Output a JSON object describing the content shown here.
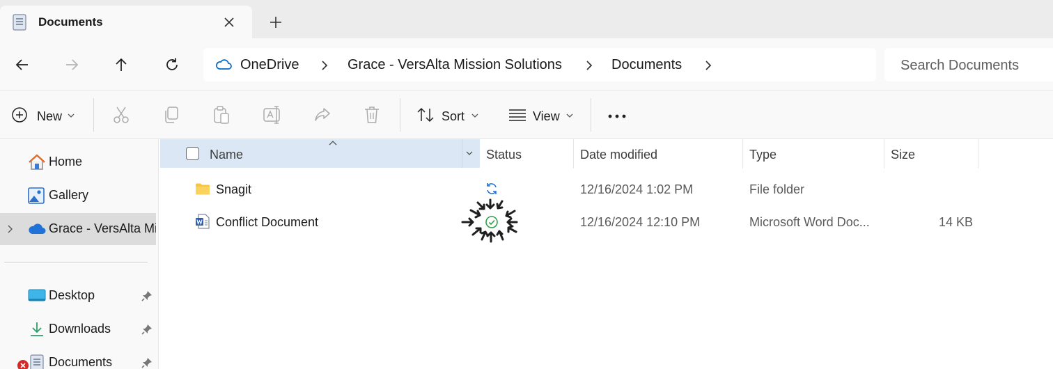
{
  "tab": {
    "title": "Documents"
  },
  "breadcrumb": {
    "items": [
      {
        "label": "OneDrive"
      },
      {
        "label": "Grace - VersAlta Mission Solutions"
      },
      {
        "label": "Documents"
      }
    ]
  },
  "search": {
    "placeholder": "Search Documents"
  },
  "toolbar": {
    "new_label": "New",
    "sort_label": "Sort",
    "view_label": "View"
  },
  "sidebar": {
    "items": [
      {
        "label": "Home"
      },
      {
        "label": "Gallery"
      },
      {
        "label": "Grace - VersAlta Mission Solutions"
      },
      {
        "label": "Desktop"
      },
      {
        "label": "Downloads"
      },
      {
        "label": "Documents"
      }
    ]
  },
  "columns": {
    "name": "Name",
    "status": "Status",
    "date": "Date modified",
    "type": "Type",
    "size": "Size"
  },
  "files": [
    {
      "name": "Snagit",
      "status": "sync-pending",
      "date": "12/16/2024 1:02 PM",
      "type": "File folder",
      "size": ""
    },
    {
      "name": "Conflict Document",
      "status": "available",
      "date": "12/16/2024 12:10 PM",
      "type": "Microsoft Word Doc...",
      "size": "14 KB"
    }
  ],
  "colors": {
    "accent": "#0067c0",
    "selection": "#dbe7f5",
    "folder": "#f8c542",
    "sync_ok": "#2e9f45",
    "error": "#d42a2a"
  }
}
